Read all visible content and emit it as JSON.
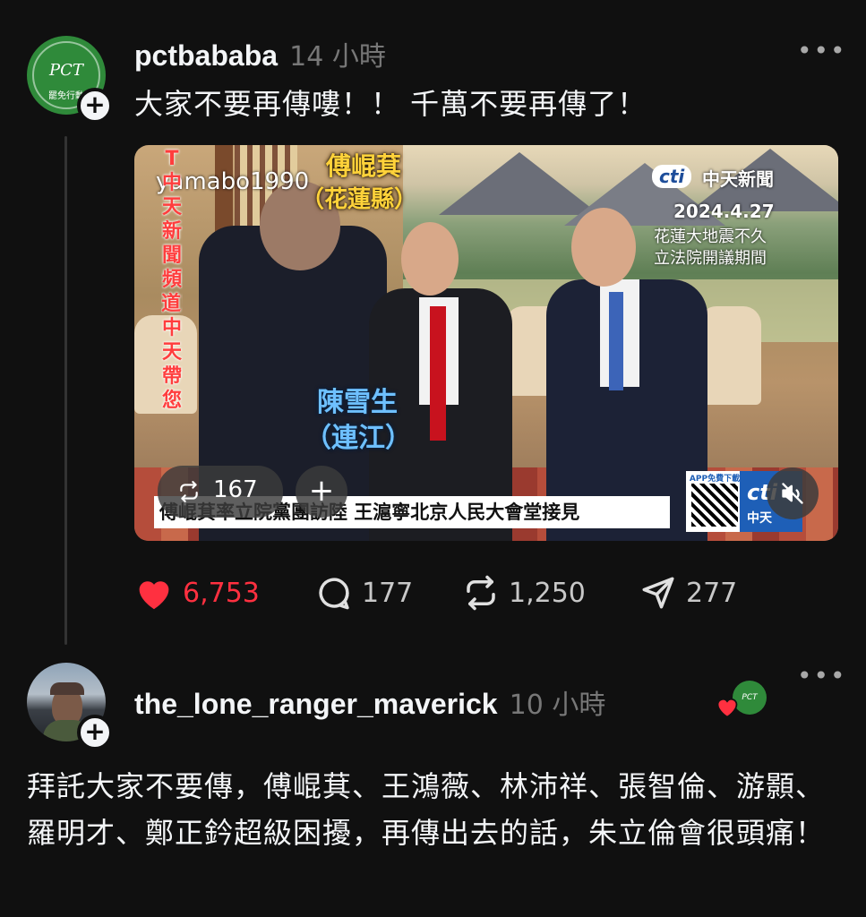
{
  "post": {
    "username": "pctbababa",
    "time": "14 小時",
    "avatar_text": "PCT",
    "avatar_subtext": "罷免行動",
    "text": "大家不要再傳嘍！！ 千萬不要再傳了！",
    "video": {
      "watermark": "yamabo1990",
      "name1": "傅崐萁",
      "region1": "（花蓮縣）",
      "name2": "陳雪生",
      "region2": "（連江）",
      "channel": "中天新聞",
      "channel_logo": "cti",
      "date": "2024.4.27",
      "note1": "花蓮大地震不久",
      "note2": "立法院開議期間",
      "side_vertical": "T中天新聞頻道！中天帶您",
      "banner": "傅崐萁率立院黨團訪陸 王滬寧北京人民大會堂接見",
      "app_label": "APP免費下載",
      "cti_box": "cti",
      "cti_box_sub": "中天",
      "repost_count": "167"
    },
    "actions": {
      "likes": "6,753",
      "comments": "177",
      "reposts": "1,250",
      "shares": "277"
    }
  },
  "reply": {
    "username": "the_lone_ranger_maverick",
    "time": "10 小時",
    "liked_by_avatar_text": "PCT",
    "text": "拜託大家不要傳，傅崐萁、王鴻薇、林沛祥、張智倫、游顥、羅明才、鄭正鈐超級困擾，再傳出去的話，朱立倫會很頭痛！"
  },
  "colors": {
    "background": "#101010",
    "like_red": "#ff3040",
    "text_primary": "#f3f5f7",
    "text_secondary": "#777777"
  }
}
